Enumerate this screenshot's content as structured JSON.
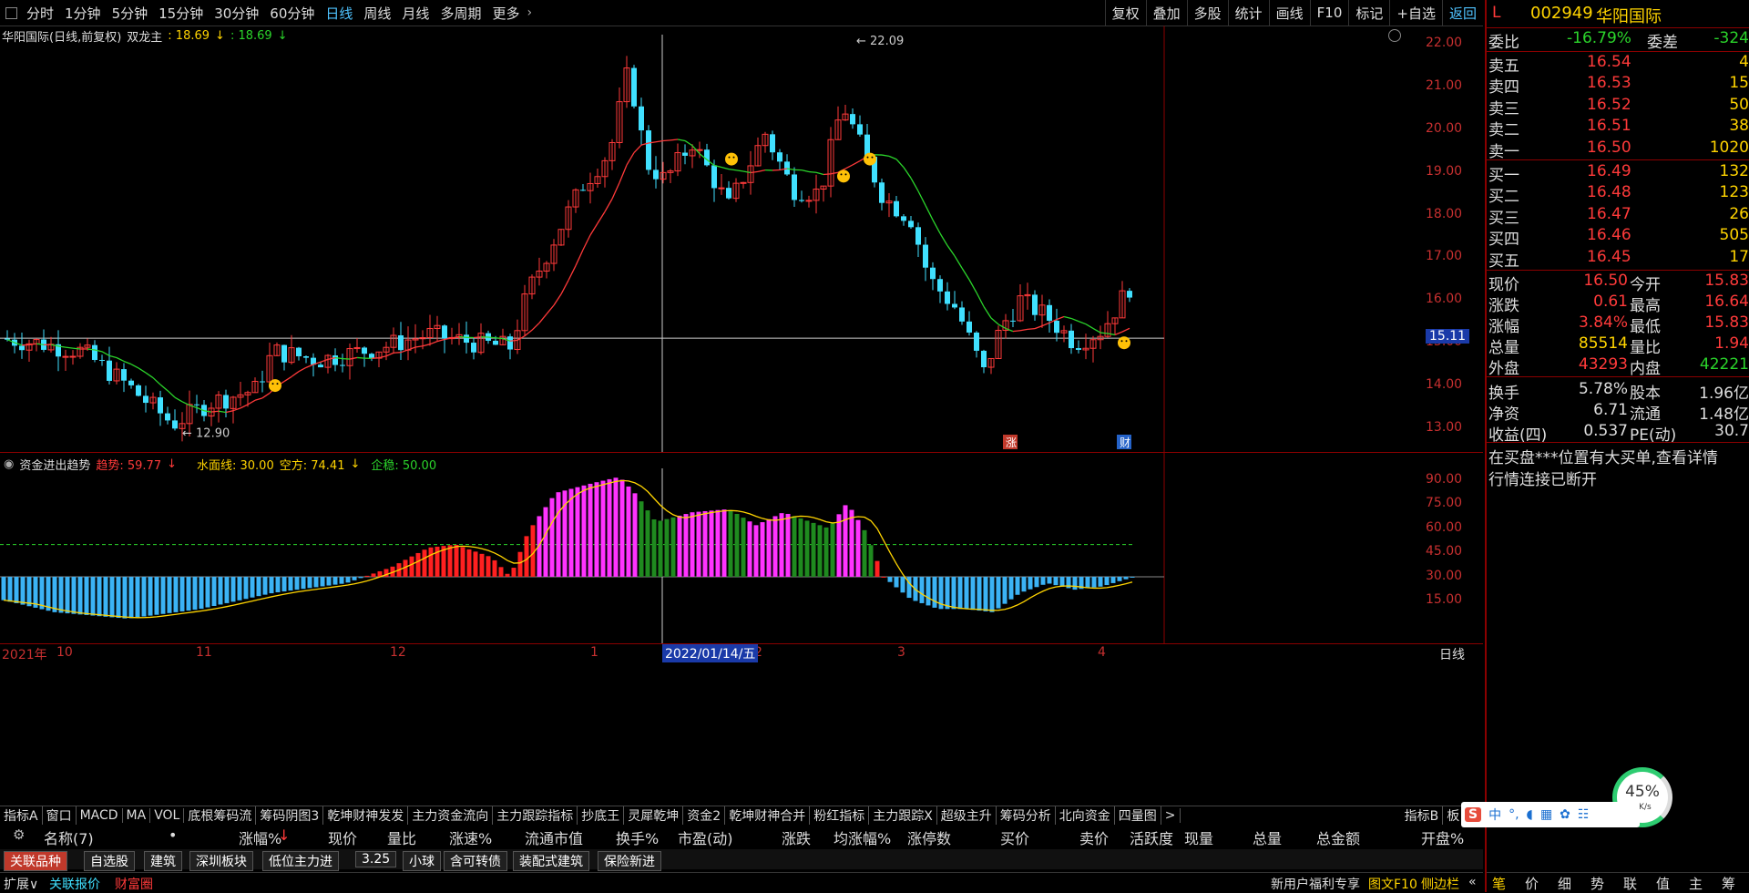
{
  "toolbar": {
    "periods": [
      "分时",
      "1分钟",
      "5分钟",
      "15分钟",
      "30分钟",
      "60分钟",
      "日线",
      "周线",
      "月线",
      "多周期",
      "更多"
    ],
    "active_period": "日线",
    "buttons": [
      "复权",
      "叠加",
      "多股",
      "统计",
      "画线",
      "F10",
      "标记",
      "+自选",
      "返回"
    ]
  },
  "main_panel": {
    "stock_name": "华阳国际(日线,前复权)",
    "indicator_name": "双龙主",
    "indicator_val1": ": 18.69",
    "indicator_val2": ": 18.69",
    "high_marker": "22.09",
    "low_marker": "12.90",
    "crosshair_price": "15.11",
    "y_labels": [
      "22.00",
      "21.00",
      "20.00",
      "19.00",
      "18.00",
      "17.00",
      "16.00",
      "15.00",
      "14.00",
      "13.00"
    ],
    "event_zhang": "涨",
    "event_cai": "财"
  },
  "sub_panel": {
    "title": "资金进出趋势",
    "trend_label": "趋势: 59.77",
    "water_label": "水面线: 30.00",
    "empty_label": "空方: 74.41",
    "stable_label": "企稳: 50.00",
    "y_labels": [
      "90.00",
      "75.00",
      "60.00",
      "45.00",
      "30.00",
      "15.00"
    ]
  },
  "date_axis": {
    "labels": [
      "2021年",
      "10",
      "11",
      "12",
      "1",
      "2",
      "3",
      "4"
    ],
    "highlight": "2022/01/14/五",
    "right": "日线"
  },
  "indicator_tabs": [
    "指标A",
    "窗口",
    "MACD",
    "MA",
    "VOL",
    "底根筹码流",
    "筹码阴图3",
    "乾坤财神发发",
    "主力资金流向",
    "主力跟踪指标",
    "抄底王",
    "灵犀乾坤",
    "资金2",
    "乾坤财神合并",
    "粉红指标",
    "主力跟踪X",
    "超级主升",
    "筹码分析",
    "北向资金",
    "四量图",
    ">"
  ],
  "indicator_tabs_right": [
    "指标B",
    "板",
    "+"
  ],
  "columns": [
    "名称(7)",
    "•",
    "涨幅%",
    "现价",
    "量比",
    "涨速%",
    "流通市值",
    "换手%",
    "市盈(动)",
    "涨跌",
    "均涨幅%",
    "涨停数",
    "买价",
    "卖价",
    "活跃度",
    "现量",
    "总量",
    "总金额",
    "开盘%"
  ],
  "categories": [
    "关联品种",
    "自选股",
    "建筑",
    "深圳板块",
    "低位主力进",
    "3.25",
    "小球",
    "含可转债",
    "装配式建筑",
    "保险新进"
  ],
  "status": {
    "left": [
      "扩展∨",
      "关联报价",
      "财富圈"
    ],
    "right": [
      "新用户福利专享",
      "图文F10",
      "侧边栏",
      "«"
    ]
  },
  "quote": {
    "flag": "L",
    "code": "002949",
    "name": "华阳国际",
    "weibi_label": "委比",
    "weibi": "-16.79%",
    "weicha_label": "委差",
    "weicha": "-324",
    "asks": [
      {
        "label": "卖五",
        "price": "16.54",
        "vol": "4"
      },
      {
        "label": "卖四",
        "price": "16.53",
        "vol": "15"
      },
      {
        "label": "卖三",
        "price": "16.52",
        "vol": "50"
      },
      {
        "label": "卖二",
        "price": "16.51",
        "vol": "38"
      },
      {
        "label": "卖一",
        "price": "16.50",
        "vol": "1020"
      }
    ],
    "bids": [
      {
        "label": "买一",
        "price": "16.49",
        "vol": "132"
      },
      {
        "label": "买二",
        "price": "16.48",
        "vol": "123"
      },
      {
        "label": "买三",
        "price": "16.47",
        "vol": "26"
      },
      {
        "label": "买四",
        "price": "16.46",
        "vol": "505"
      },
      {
        "label": "买五",
        "price": "16.45",
        "vol": "17"
      }
    ],
    "stats": [
      {
        "l1": "现价",
        "v1": "16.50",
        "l2": "今开",
        "v2": "15.83",
        "c1": "red",
        "c2": "red"
      },
      {
        "l1": "涨跌",
        "v1": "0.61",
        "l2": "最高",
        "v2": "16.64",
        "c1": "red",
        "c2": "red"
      },
      {
        "l1": "涨幅",
        "v1": "3.84%",
        "l2": "最低",
        "v2": "15.83",
        "c1": "red",
        "c2": "red"
      },
      {
        "l1": "总量",
        "v1": "85514",
        "l2": "量比",
        "v2": "1.94",
        "c1": "yellow",
        "c2": "red"
      },
      {
        "l1": "外盘",
        "v1": "43293",
        "l2": "内盘",
        "v2": "42221",
        "c1": "red",
        "c2": "green"
      }
    ],
    "stats2": [
      {
        "l1": "换手",
        "v1": "5.78%",
        "l2": "股本",
        "v2": "1.96亿"
      },
      {
        "l1": "净资",
        "v1": "6.71",
        "l2": "流通",
        "v2": "1.48亿"
      },
      {
        "l1": "收益(四)",
        "v1": "0.537",
        "l2": "PE(动)",
        "v2": "30.7"
      }
    ],
    "notice1": "在买盘***位置有大买单,查看详情",
    "notice2": "行情连接已断开",
    "speed_pct": "45%",
    "speed_rate": "0K/s",
    "bottom_tabs": [
      "笔",
      "价",
      "细",
      "势",
      "联",
      "值",
      "主",
      "筹"
    ]
  }
}
